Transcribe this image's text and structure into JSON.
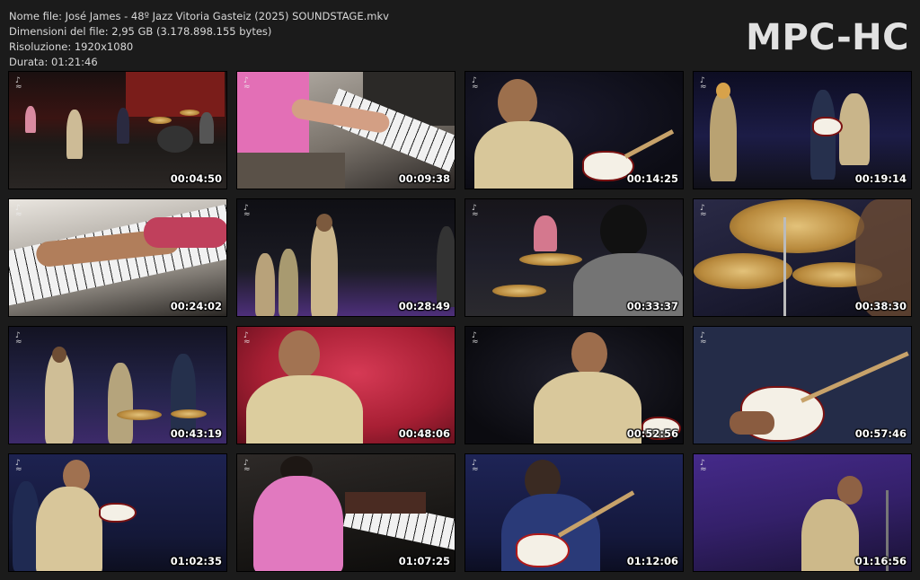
{
  "header": {
    "file_name": "Nome file: José James - 48º Jazz Vitoria Gasteiz (2025) SOUNDSTAGE.mkv",
    "file_size": "Dimensioni del file: 2,95 GB (3.178.898.155 bytes)",
    "resolution": "Risoluzione: 1920x1080",
    "duration": "Durata: 01:21:46"
  },
  "brand": "MPC-HC",
  "thumbnails": [
    {
      "time": "00:04:50",
      "icon": "festival-logo-icon"
    },
    {
      "time": "00:09:38",
      "icon": "festival-logo-icon"
    },
    {
      "time": "00:14:25",
      "icon": "festival-logo-icon"
    },
    {
      "time": "00:19:14",
      "icon": "festival-logo-icon"
    },
    {
      "time": "00:24:02",
      "icon": "festival-logo-icon"
    },
    {
      "time": "00:28:49",
      "icon": "festival-logo-icon"
    },
    {
      "time": "00:33:37",
      "icon": "festival-logo-icon"
    },
    {
      "time": "00:38:30",
      "icon": "festival-logo-icon"
    },
    {
      "time": "00:43:19",
      "icon": "festival-logo-icon"
    },
    {
      "time": "00:48:06",
      "icon": "festival-logo-icon"
    },
    {
      "time": "00:52:56",
      "icon": "festival-logo-icon"
    },
    {
      "time": "00:57:46",
      "icon": "festival-logo-icon"
    },
    {
      "time": "01:02:35",
      "icon": "festival-logo-icon"
    },
    {
      "time": "01:07:25",
      "icon": "festival-logo-icon"
    },
    {
      "time": "01:12:06",
      "icon": "festival-logo-icon"
    },
    {
      "time": "01:16:56",
      "icon": "festival-logo-icon"
    }
  ]
}
